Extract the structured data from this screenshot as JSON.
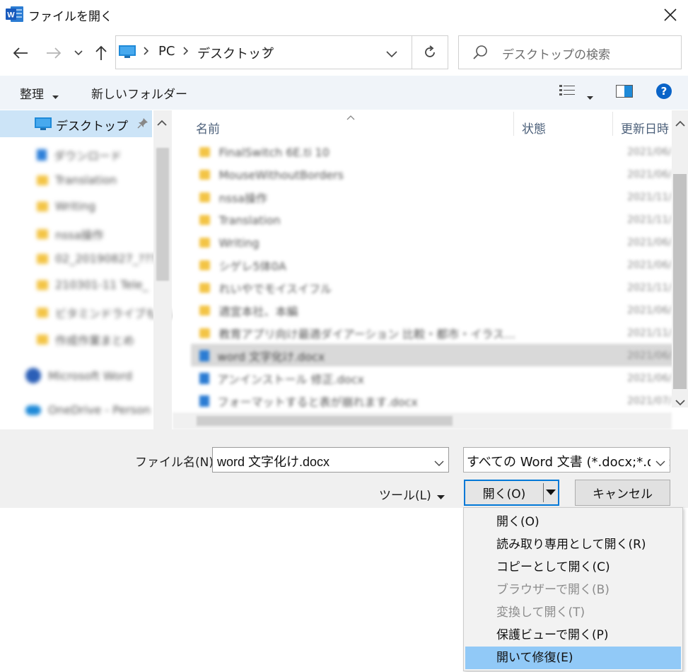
{
  "window": {
    "title": "ファイルを開く",
    "app_icon_letter": "W"
  },
  "address": {
    "crumbs": [
      "PC",
      "デスクトップ"
    ],
    "search_placeholder": "デスクトップの検索"
  },
  "toolbar": {
    "organize_label": "整理",
    "new_folder_label": "新しいフォルダー"
  },
  "nav": {
    "pinned_desktop_label": "デスクトップ",
    "items": [
      "ダウンロード",
      "Translation",
      "Writing",
      "nssa操作",
      "02_20190827_???",
      "210301-11 Tele_",
      "ビタミンドライブもよい",
      "作成作業まとめ",
      "Microsoft Word",
      "OneDrive - Person"
    ]
  },
  "filelist": {
    "columns": [
      "名前",
      "状態",
      "更新日時"
    ],
    "rows": [
      {
        "name": "FinalSwitch 6E.ti 10",
        "date": "2021/06/",
        "type": "folder"
      },
      {
        "name": "MouseWithoutBorders",
        "date": "2021/06/",
        "type": "folder"
      },
      {
        "name": "nssa操作",
        "date": "2021/11/",
        "type": "folder"
      },
      {
        "name": "Translation",
        "date": "2021/11/",
        "type": "folder"
      },
      {
        "name": "Writing",
        "date": "2021/06/",
        "type": "folder"
      },
      {
        "name": "シゲレ5体0A",
        "date": "2021/06/",
        "type": "folder"
      },
      {
        "name": "れいやでモイスイフル",
        "date": "2021/11/",
        "type": "folder"
      },
      {
        "name": "適宜本社、本編",
        "date": "2021/06/",
        "type": "folder"
      },
      {
        "name": "教育アプリ向け最適ダイアーション 比較・都市・イラス…",
        "date": "2021/11/",
        "type": "folder"
      },
      {
        "name": "word 文字化け.docx",
        "date": "2021/06/",
        "type": "doc"
      },
      {
        "name": "アンインストール 修正.docx",
        "date": "2021/06/",
        "type": "doc"
      },
      {
        "name": "フォーマットすると表が崩れます.docx",
        "date": "2021/07/",
        "type": "doc"
      }
    ]
  },
  "bottom": {
    "filename_label": "ファイル名(N):",
    "filename_value": "word 文字化け.docx",
    "filetype_value": "すべての Word 文書 (*.docx;*.doc",
    "tools_label": "ツール(L)",
    "open_label": "開く(O)",
    "cancel_label": "キャンセル"
  },
  "open_menu": [
    {
      "label": "開く(O)",
      "enabled": true,
      "highlighted": false
    },
    {
      "label": "読み取り専用として開く(R)",
      "enabled": true,
      "highlighted": false
    },
    {
      "label": "コピーとして開く(C)",
      "enabled": true,
      "highlighted": false
    },
    {
      "label": "ブラウザーで開く(B)",
      "enabled": false,
      "highlighted": false
    },
    {
      "label": "変換して開く(T)",
      "enabled": false,
      "highlighted": false
    },
    {
      "label": "保護ビューで開く(P)",
      "enabled": true,
      "highlighted": false
    },
    {
      "label": "開いて修復(E)",
      "enabled": true,
      "highlighted": true
    }
  ],
  "colors": {
    "accent": "#0078d7",
    "menu_highlight": "#91c9f7",
    "nav_selected": "#cce4f7",
    "help_blue": "#0a64c8"
  }
}
